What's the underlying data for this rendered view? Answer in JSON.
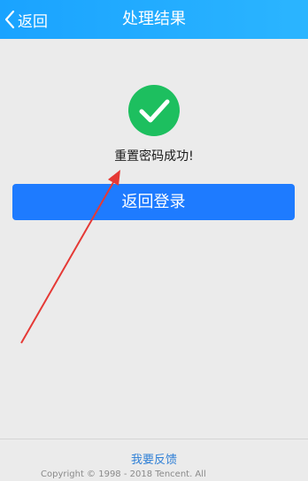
{
  "header": {
    "back_label": "返回",
    "title": "处理结果"
  },
  "result": {
    "icon": "check-circle-icon",
    "message": "重置密码成功!"
  },
  "actions": {
    "back_to_login_label": "返回登录"
  },
  "footer": {
    "feedback_label": "我要反馈",
    "copyright": "Copyright © 1998 - 2018 Tencent. All"
  },
  "colors": {
    "header": "#1aa3ff",
    "success": "#1dbf5f",
    "primary_button": "#1e7bff",
    "annotation_arrow": "#e53935"
  }
}
